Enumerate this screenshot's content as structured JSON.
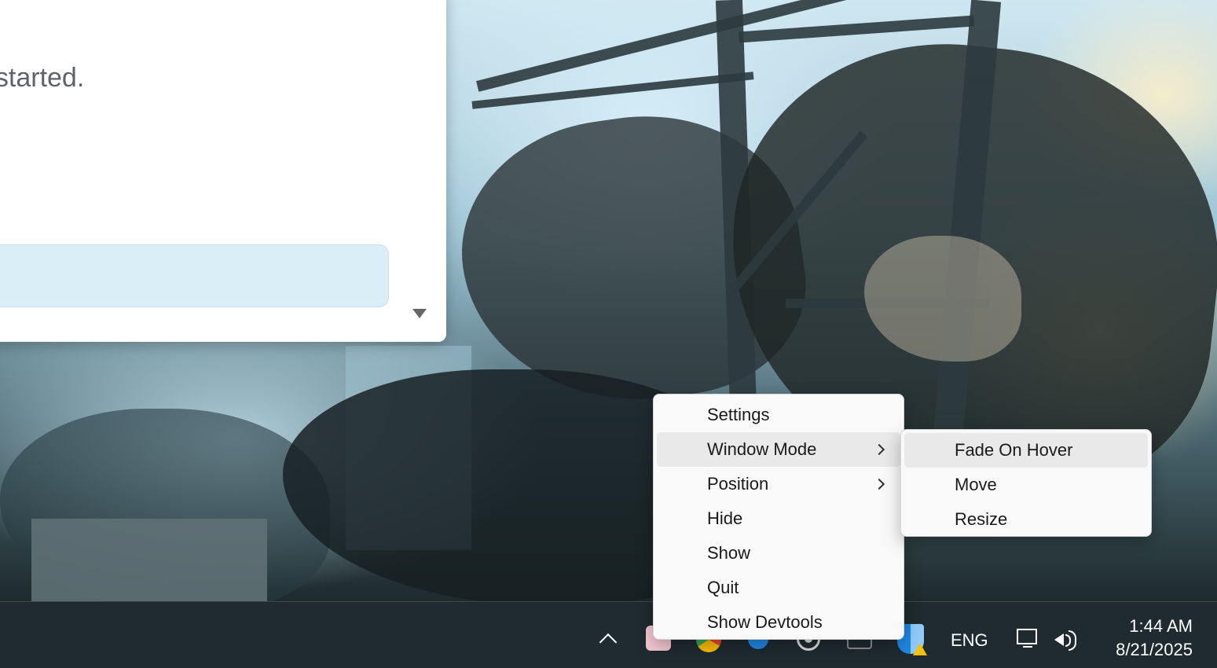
{
  "app_window": {
    "text": "t started."
  },
  "context_menu": {
    "items": [
      {
        "label": "Settings"
      },
      {
        "label": "Window Mode"
      },
      {
        "label": "Position"
      },
      {
        "label": "Hide"
      },
      {
        "label": "Show"
      },
      {
        "label": "Quit"
      },
      {
        "label": "Show Devtools"
      }
    ]
  },
  "submenu": {
    "items": [
      {
        "label": "Fade On Hover"
      },
      {
        "label": "Move"
      },
      {
        "label": "Resize"
      }
    ]
  },
  "taskbar": {
    "language": "ENG",
    "time": "1:44 AM",
    "date": "8/21/2025",
    "tray_icons": [
      "chevron-up-icon",
      "app-icon",
      "chrome-icon",
      "bluetooth-icon",
      "disk-icon",
      "chat-icon",
      "security-warning-icon"
    ]
  },
  "colors": {
    "taskbar_bg": "#1f2b30",
    "menu_bg": "#f9f9f9",
    "menu_hover": "#e9e9e9",
    "input_bg": "#d9eef6"
  }
}
